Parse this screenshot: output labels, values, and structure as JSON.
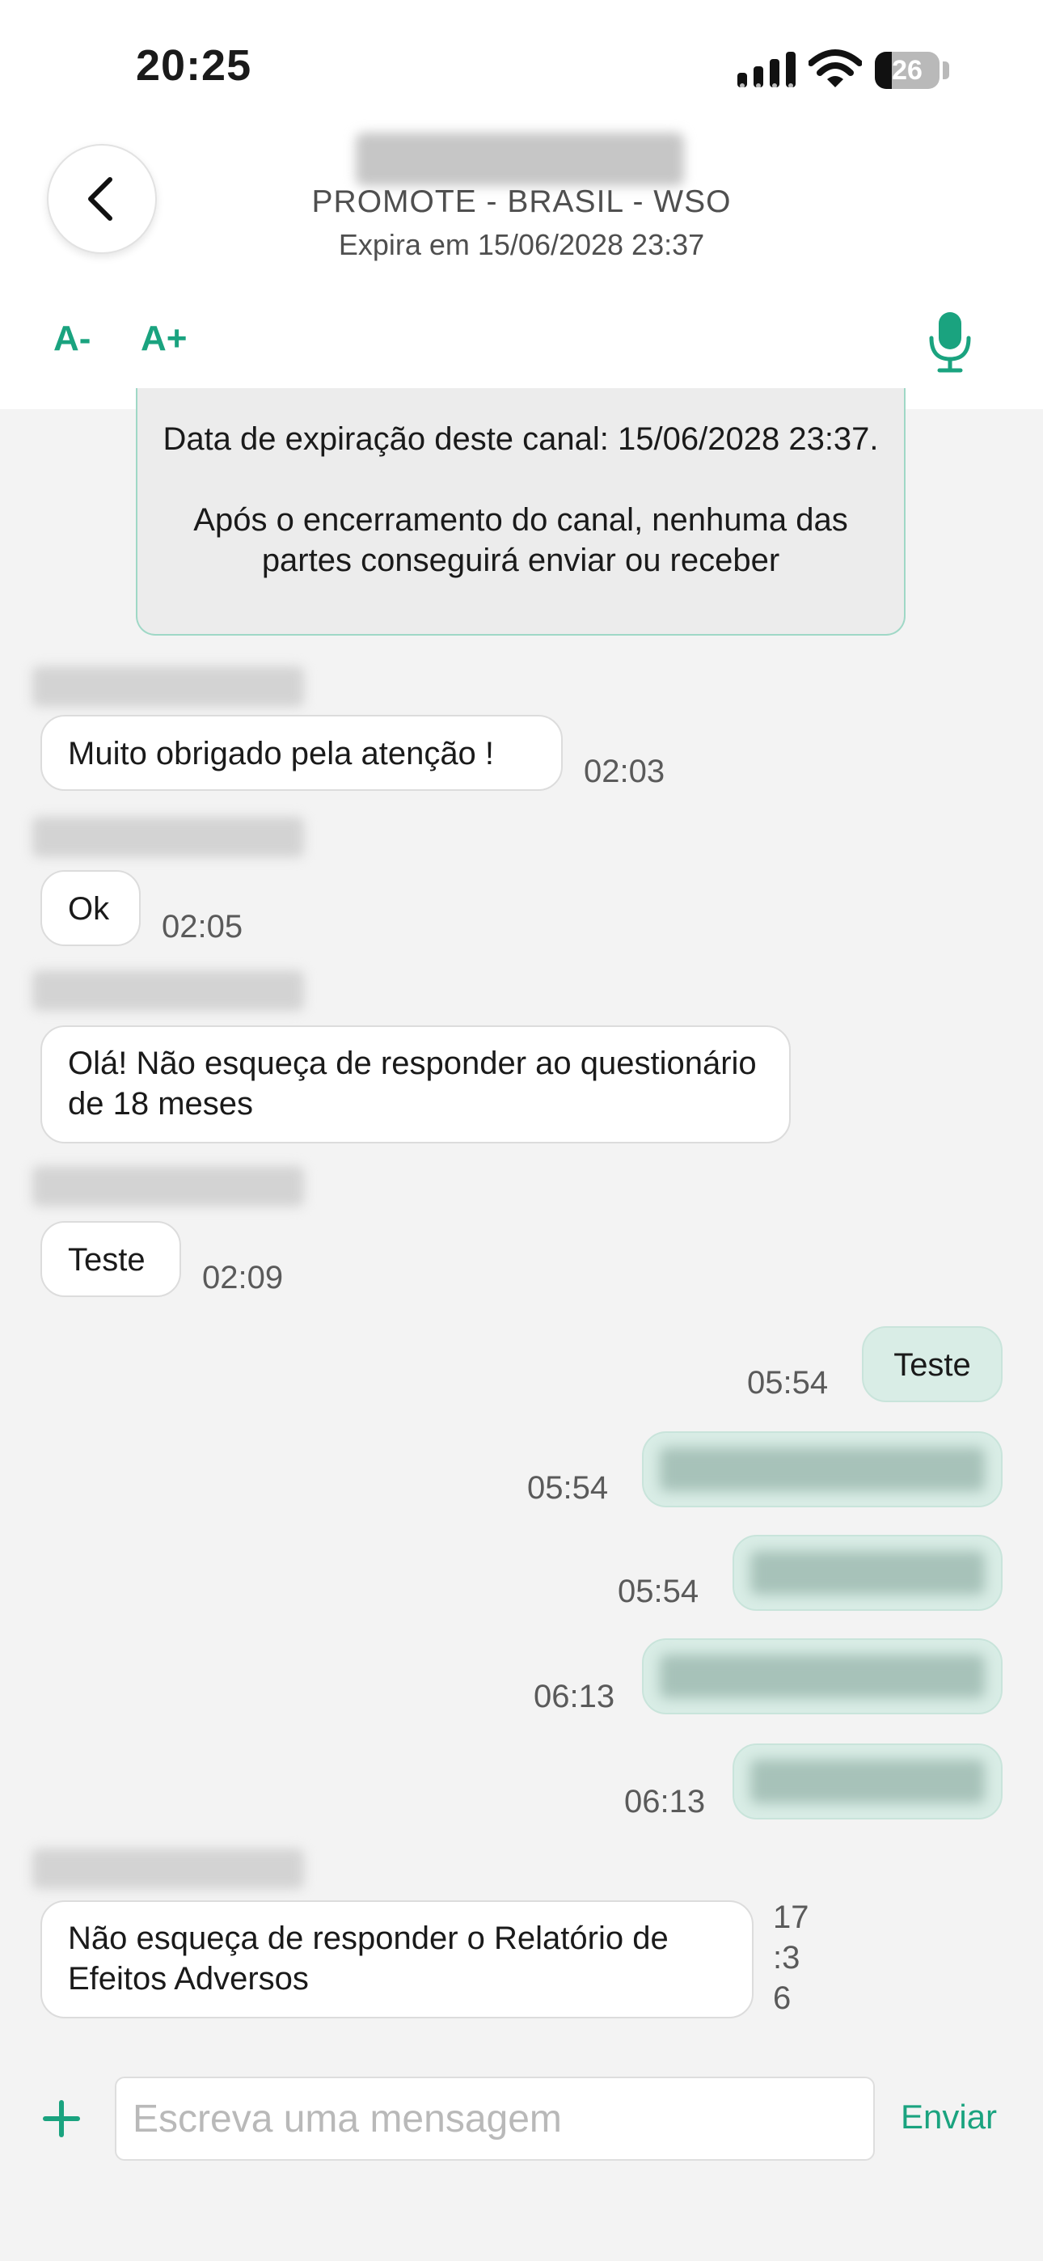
{
  "status_bar": {
    "time": "20:25",
    "battery": "26",
    "battery_level": 0.26
  },
  "header": {
    "channel_name": "PROMOTE - BRASIL - WSO",
    "expiry": "Expira em 15/06/2028 23:37"
  },
  "toolbar": {
    "font_decrease": "A-",
    "font_increase": "A+"
  },
  "system_message": {
    "line1": "Data de expiração deste canal: 15/06/2028 23:37.",
    "line2": "Após o encerramento do canal, nenhuma das partes conseguirá enviar ou receber"
  },
  "messages": [
    {
      "direction": "in",
      "text": "Muito obrigado pela atenção !",
      "time": "02:03"
    },
    {
      "direction": "in",
      "text": "Ok",
      "time": "02:05"
    },
    {
      "direction": "in",
      "text": "Olá! Não esqueça de responder ao questionário de 18 meses",
      "time": ""
    },
    {
      "direction": "in",
      "text": "Teste",
      "time": "02:09"
    },
    {
      "direction": "out",
      "text": "Teste",
      "time": "05:54"
    },
    {
      "direction": "out",
      "text": "",
      "time": "05:54"
    },
    {
      "direction": "out",
      "text": "",
      "time": "05:54"
    },
    {
      "direction": "out",
      "text": "",
      "time": "06:13"
    },
    {
      "direction": "out",
      "text": "",
      "time": "06:13"
    },
    {
      "direction": "in",
      "text": "Não esqueça de responder o Relatório de Efeitos Adversos",
      "time_lines": [
        "17",
        ":3",
        "6"
      ]
    }
  ],
  "composer": {
    "placeholder": "Escreva uma mensagem",
    "send_label": "Enviar"
  },
  "colors": {
    "accent": "#1aa37f",
    "outgoing_bubble": "#d9ede6",
    "background": "#f3f3f3"
  },
  "icons": [
    "signal-icon",
    "wifi-icon",
    "battery-icon",
    "back-chevron-icon",
    "microphone-icon",
    "plus-icon"
  ]
}
